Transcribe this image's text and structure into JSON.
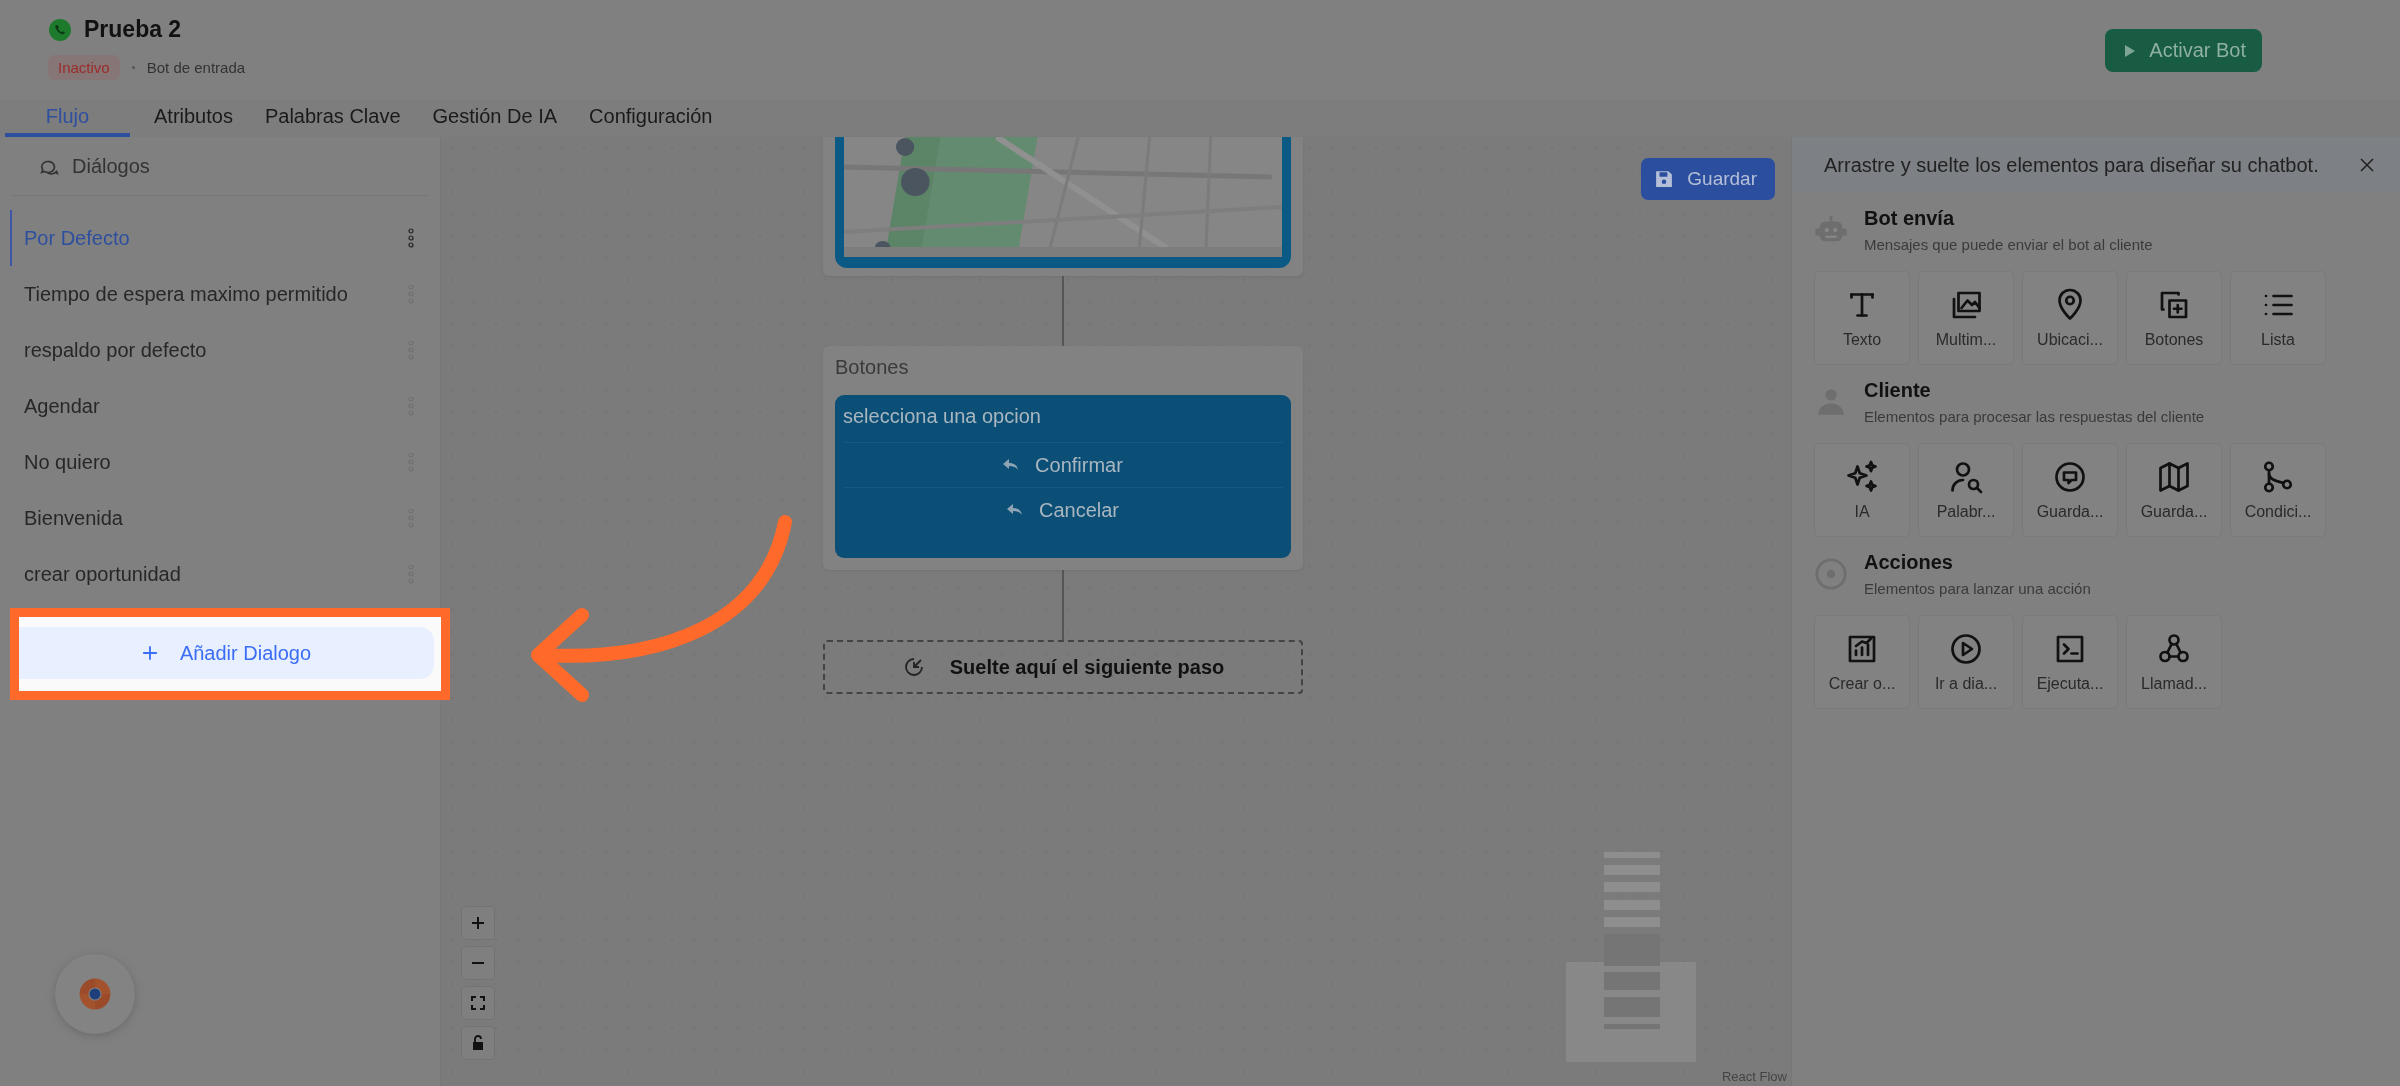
{
  "app": {
    "title": "Prueba 2",
    "status": "Inactivo",
    "bot_type": "Bot de entrada",
    "primary_action": "Activar Bot"
  },
  "tabs": [
    {
      "label": "Flujo",
      "selected": true
    },
    {
      "label": "Atributos",
      "selected": false
    },
    {
      "label": "Palabras Clave",
      "selected": false
    },
    {
      "label": "Gestión De IA",
      "selected": false
    },
    {
      "label": "Configuración",
      "selected": false
    }
  ],
  "sidebar": {
    "title": "Diálogos",
    "items": [
      {
        "label": "Por Defecto",
        "selected": true
      },
      {
        "label": "Tiempo de espera maximo permitido",
        "selected": false
      },
      {
        "label": "respaldo por defecto",
        "selected": false
      },
      {
        "label": "Agendar",
        "selected": false
      },
      {
        "label": "No quiero",
        "selected": false
      },
      {
        "label": "Bienvenida",
        "selected": false
      },
      {
        "label": "crear oportunidad",
        "selected": false
      }
    ],
    "add_button": "Añadir Dialogo"
  },
  "canvas": {
    "save_button": "Guardar",
    "attribution": "React Flow",
    "nodes": [
      {
        "kind": "map"
      },
      {
        "kind": "buttons",
        "title": "Botones",
        "message": "selecciona una opcion",
        "options": [
          "Confirmar",
          "Cancelar"
        ]
      },
      {
        "kind": "dropzone",
        "label": "Suelte aquí el siguiente paso"
      }
    ]
  },
  "palette": {
    "hint": "Arrastre y suelte los elementos para diseñar su chatbot.",
    "sections": [
      {
        "title": "Bot envía",
        "subtitle": "Mensajes que puede enviar el bot al cliente",
        "items": [
          "Texto",
          "Multim...",
          "Ubicaci...",
          "Botones",
          "Lista"
        ]
      },
      {
        "title": "Cliente",
        "subtitle": "Elementos para procesar las respuestas del cliente",
        "items": [
          "IA",
          "Palabr...",
          "Guarda...",
          "Guarda...",
          "Condici..."
        ]
      },
      {
        "title": "Acciones",
        "subtitle": "Elementos para lanzar una acción",
        "items": [
          "Crear o...",
          "Ir a dia...",
          "Ejecuta...",
          "Llamad..."
        ]
      }
    ]
  }
}
